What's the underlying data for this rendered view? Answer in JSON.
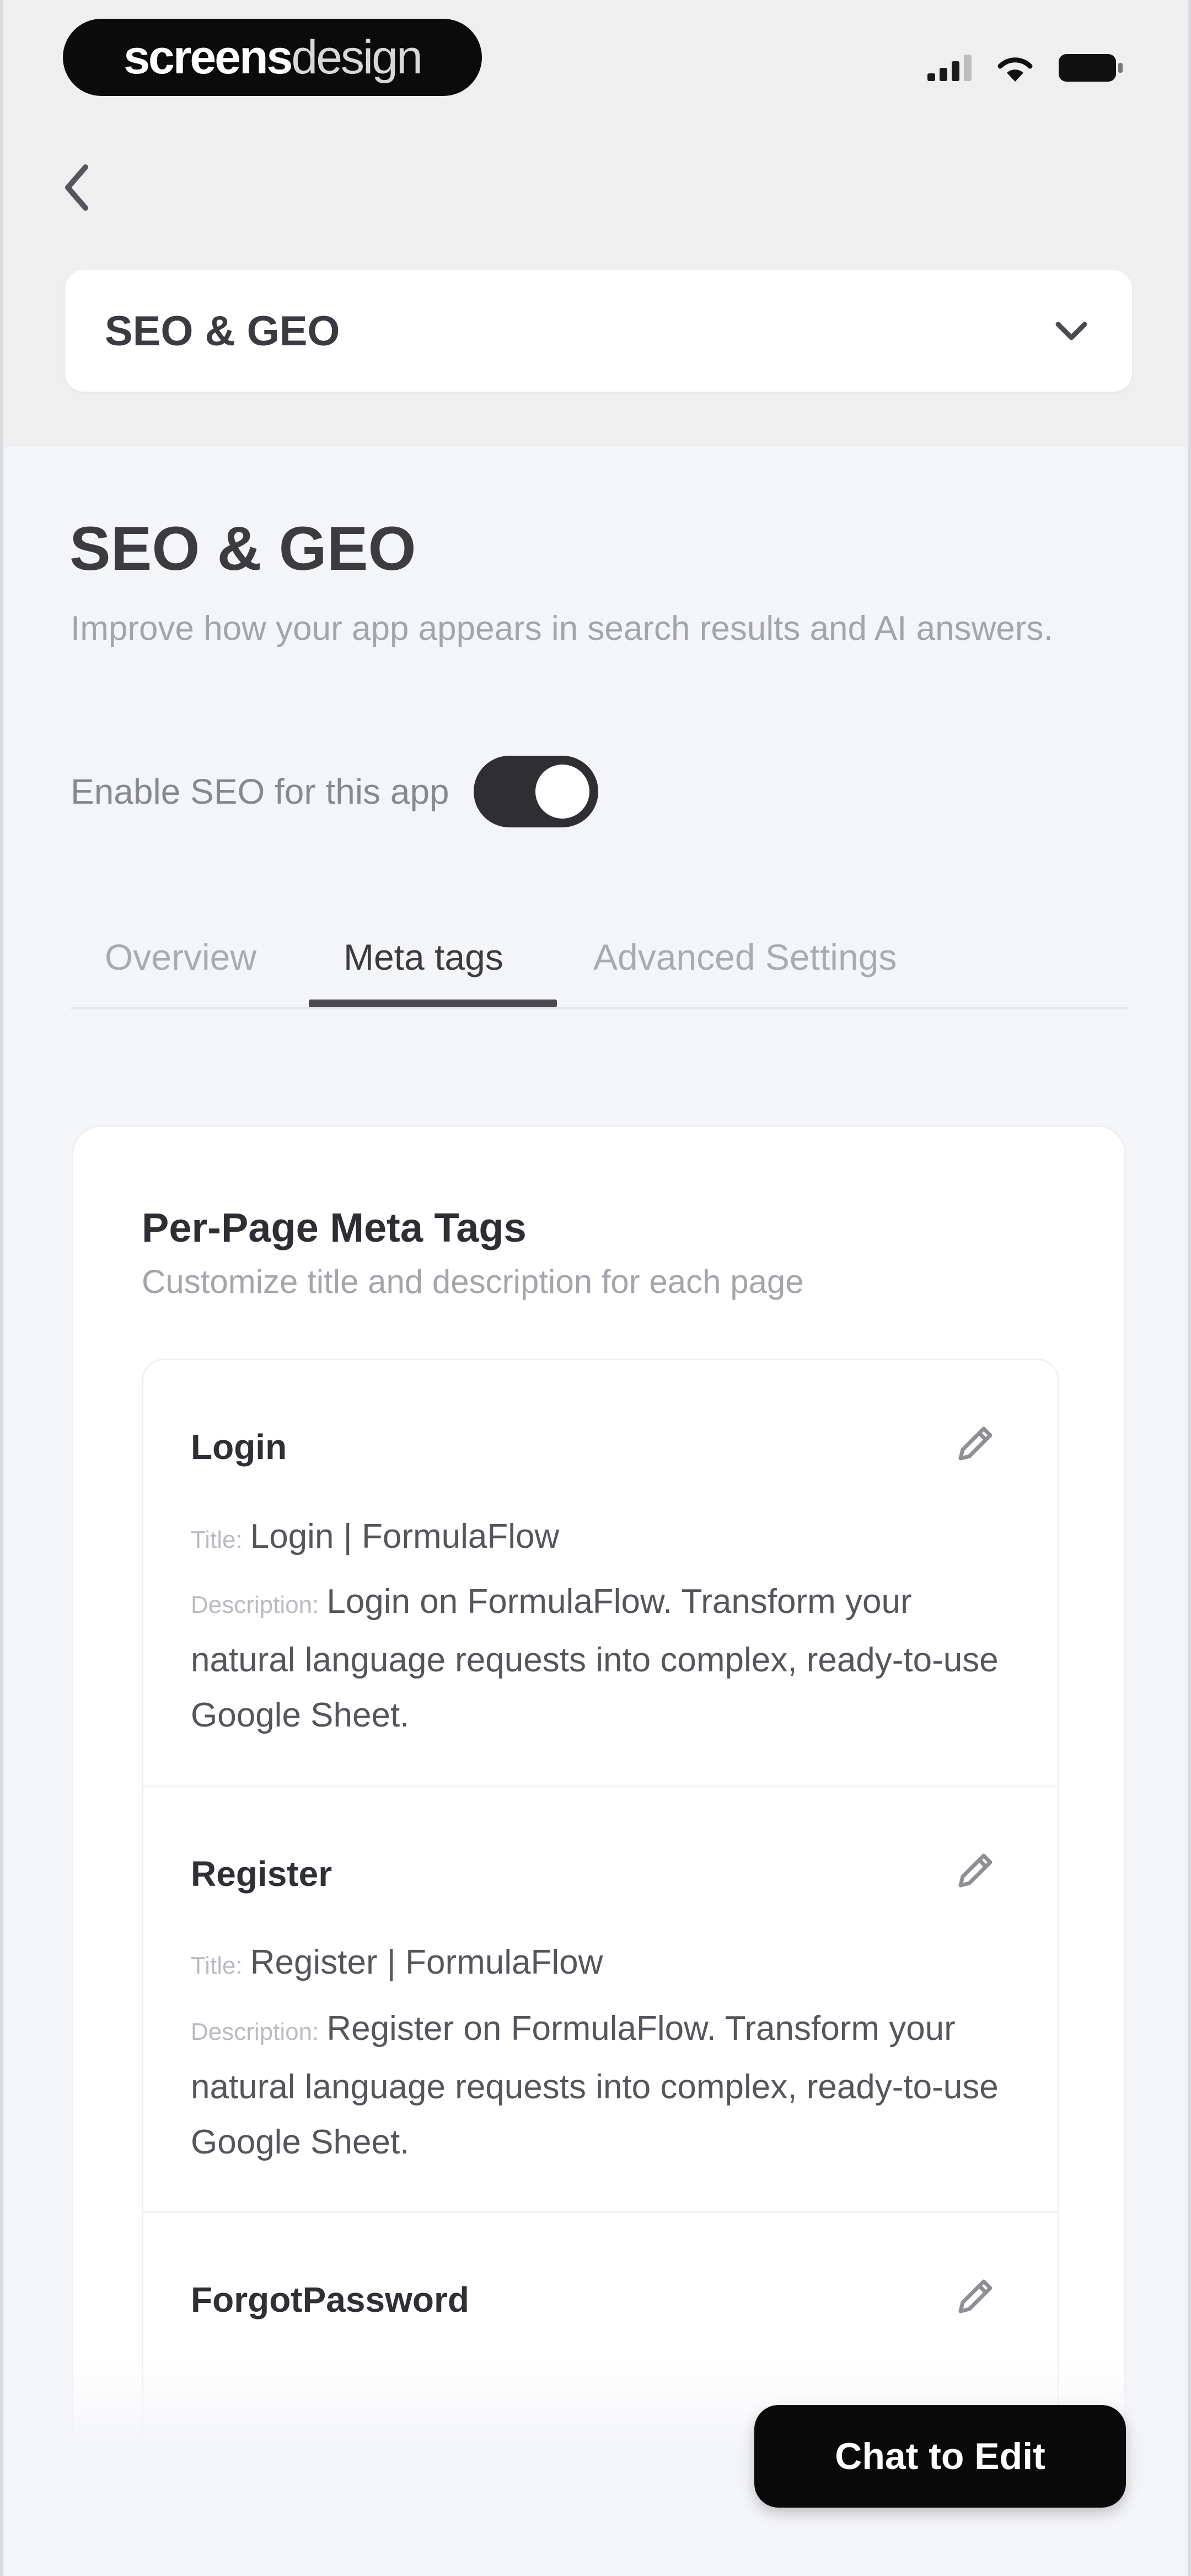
{
  "status_bar": {
    "brand_bold": "screens",
    "brand_light": "design"
  },
  "header": {
    "dropdown_value": "SEO & GEO"
  },
  "main": {
    "title": "SEO & GEO",
    "subtitle": "Improve how your app appears in search results and AI answers.",
    "toggle_label": "Enable SEO for this app",
    "toggle_on": true,
    "tabs": [
      {
        "label": "Overview",
        "active": false
      },
      {
        "label": "Meta tags",
        "active": true
      },
      {
        "label": "Advanced Settings",
        "active": false
      }
    ]
  },
  "card": {
    "title": "Per-Page Meta Tags",
    "subtitle": "Customize title and description for each page",
    "title_key": "Title:",
    "description_key": "Description:",
    "pages": [
      {
        "name": "Login",
        "title": "Login | FormulaFlow",
        "description": "Login on FormulaFlow. Transform your natural language requests into complex, ready-to-use Google Sheet."
      },
      {
        "name": "Register",
        "title": "Register | FormulaFlow",
        "description": "Register on FormulaFlow. Transform your natural language requests into complex, ready-to-use Google Sheet."
      },
      {
        "name": "ForgotPassword"
      }
    ]
  },
  "actions": {
    "chat_button": "Chat to Edit"
  },
  "icons": {
    "back": "chevron-left-icon",
    "dropdown": "chevron-down-icon",
    "edit": "pencil-icon",
    "signal": "cellular-signal-icon",
    "wifi": "wifi-icon",
    "battery": "battery-icon"
  }
}
